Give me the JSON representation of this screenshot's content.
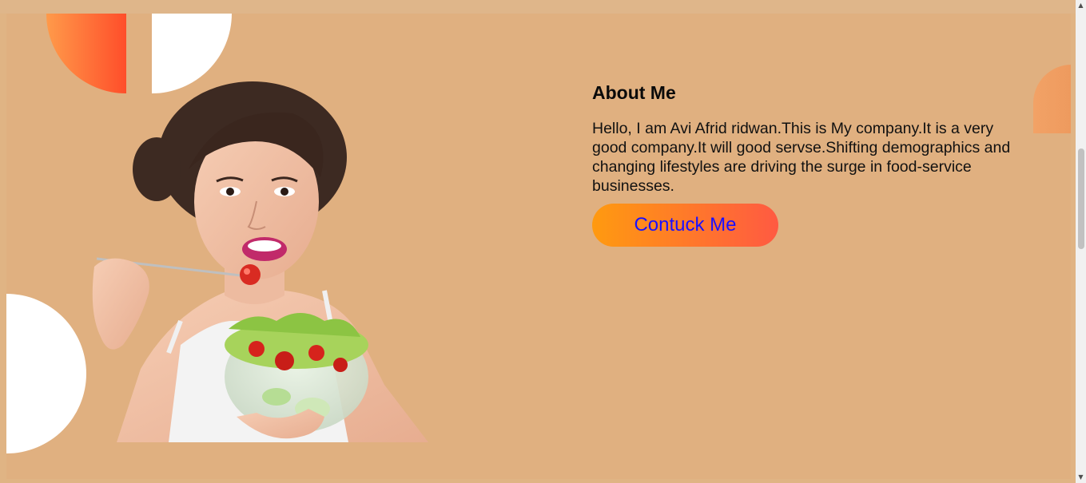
{
  "about": {
    "heading": "About Me",
    "text": "Hello, I am Avi Afrid ridwan.This is My company.It is a very good company.It will good servse.Shifting demographics and changing lifestyles are driving the surge in food-service businesses.",
    "button_label": "Contuck Me"
  },
  "colors": {
    "page_background": "#e0b080",
    "button_gradient_start": "#ff9a10",
    "button_gradient_end": "#ff5a42",
    "button_text": "#1a10ff",
    "accent_orange": "#ff4e2a"
  },
  "images": {
    "hero": "woman-eating-salad-image"
  },
  "icons": {
    "scroll_up": "arrow-up-icon",
    "scroll_down": "arrow-down-icon"
  }
}
